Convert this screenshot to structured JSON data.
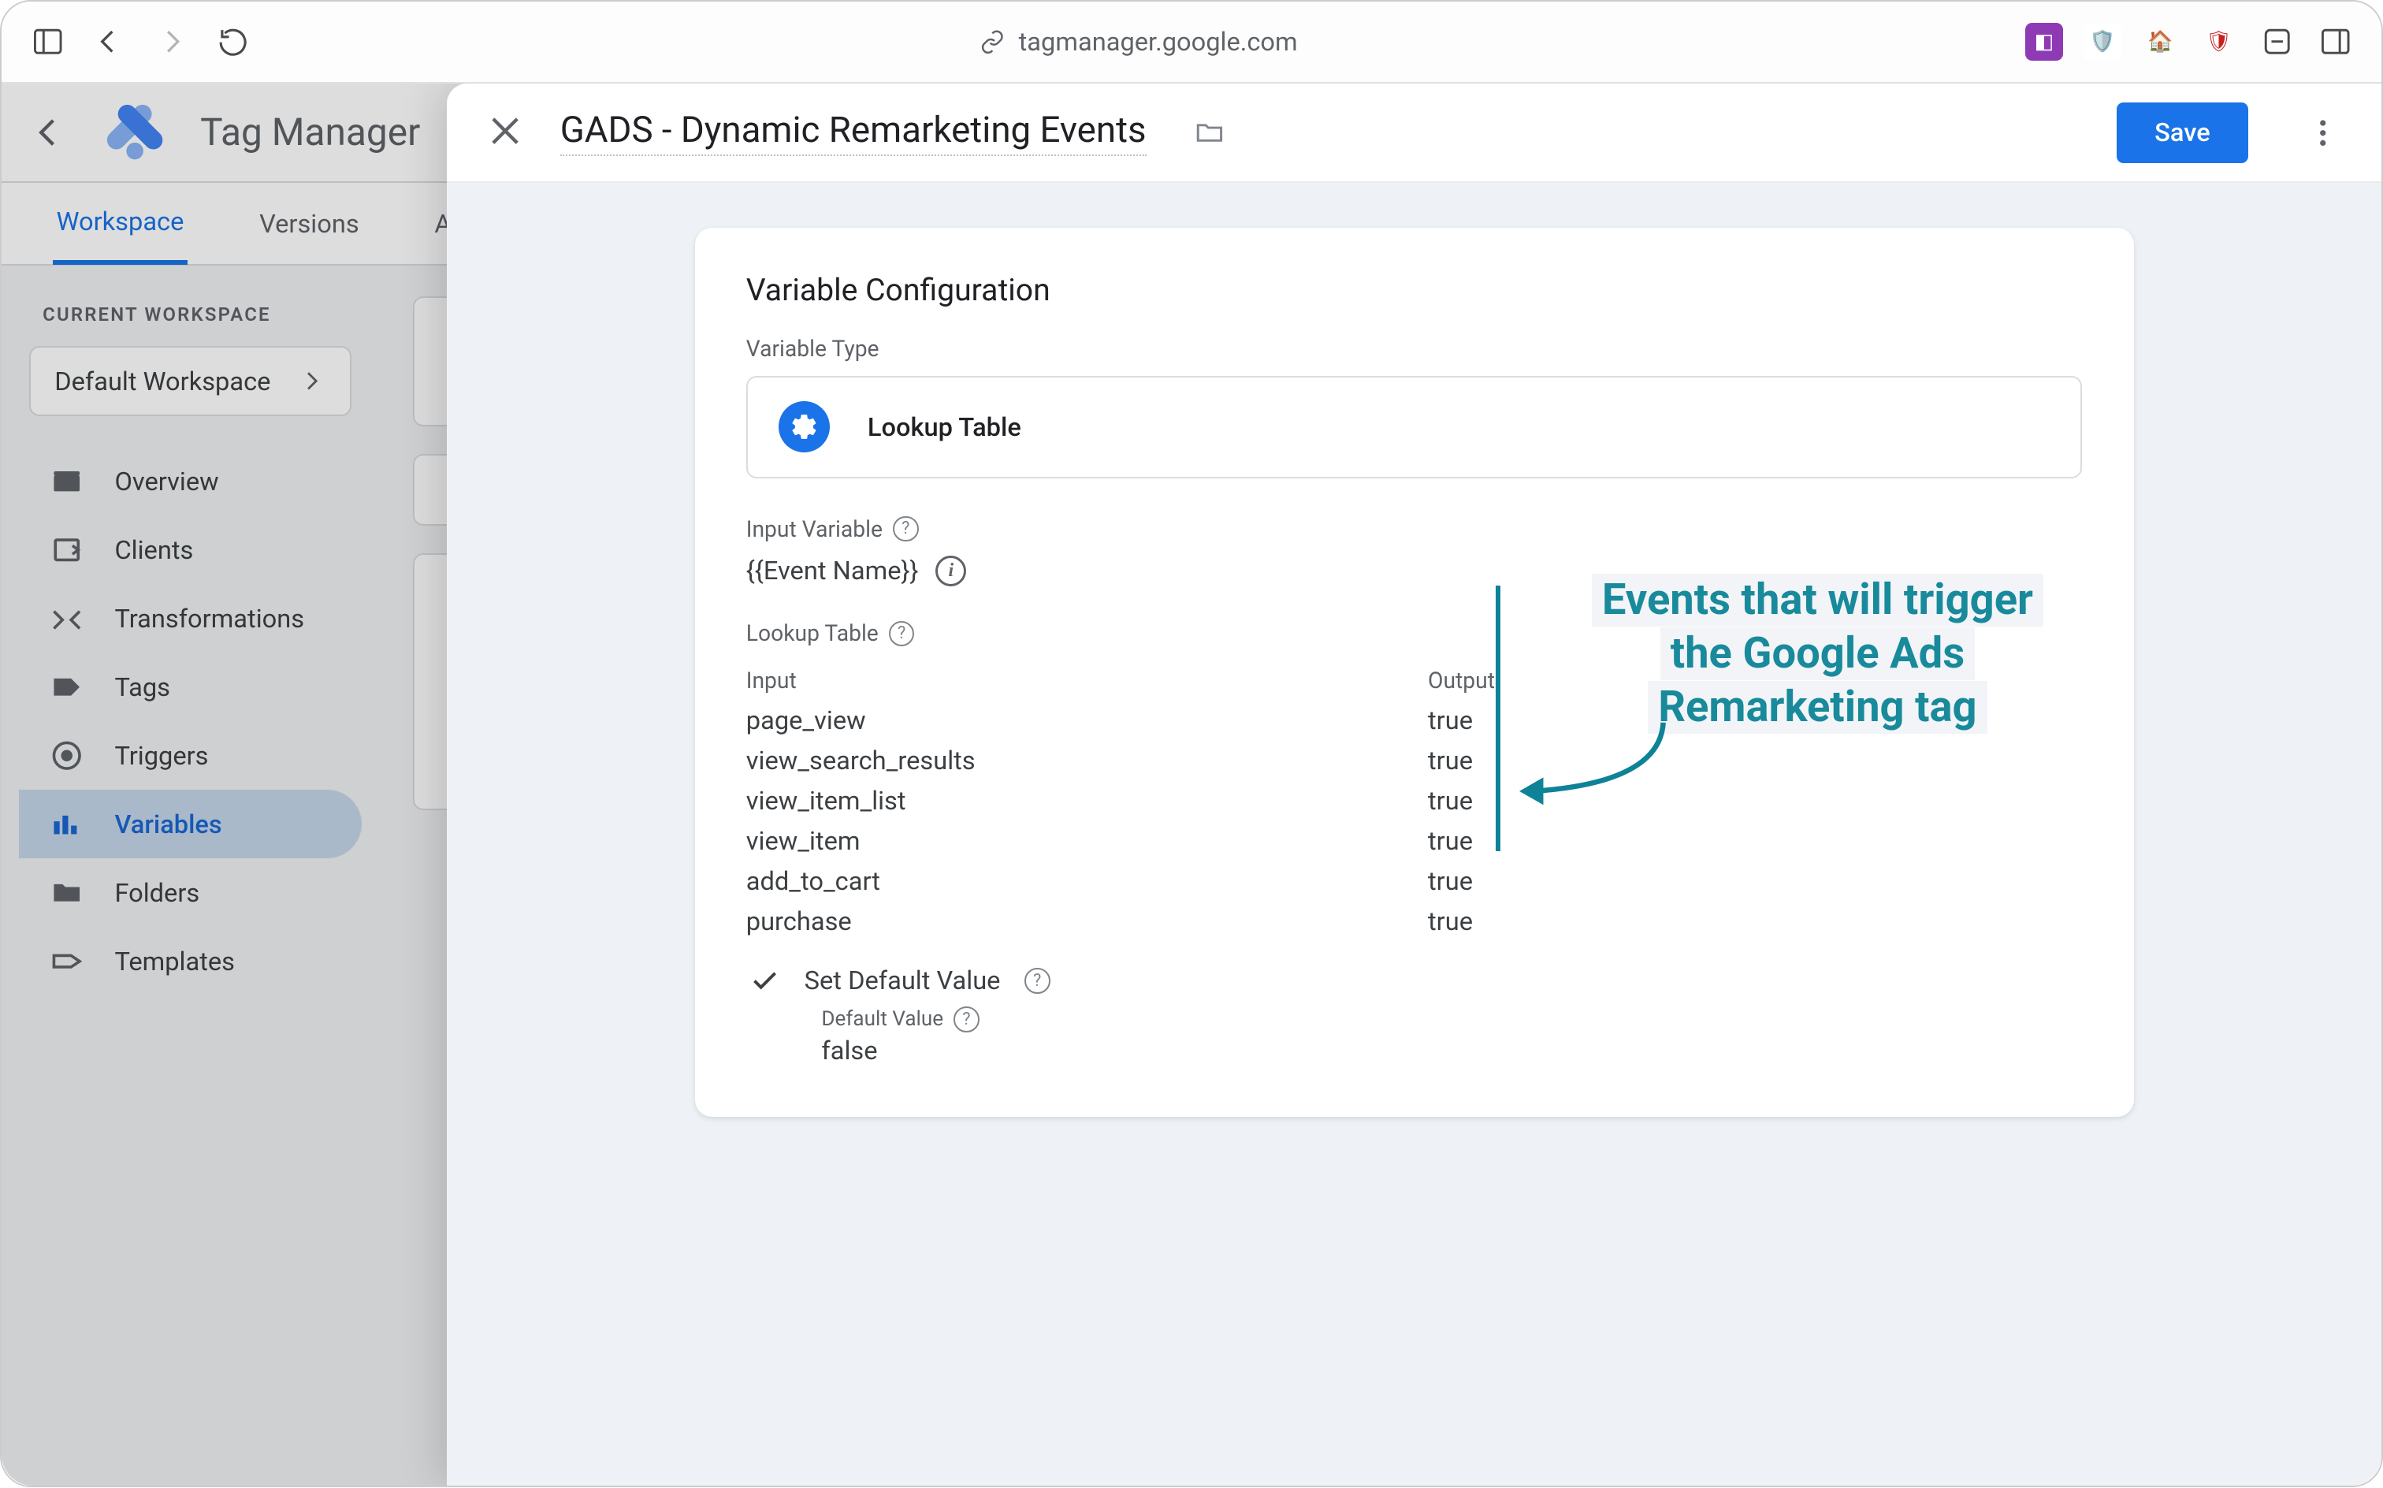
{
  "browser": {
    "url": "tagmanager.google.com"
  },
  "gtm": {
    "product": "Tag Manager",
    "tabs": {
      "workspace": "Workspace",
      "versions": "Versions",
      "admin": "Admin"
    },
    "ws_label": "CURRENT WORKSPACE",
    "ws_name": "Default Workspace",
    "nav": {
      "overview": "Overview",
      "clients": "Clients",
      "transformations": "Transformations",
      "tags": "Tags",
      "triggers": "Triggers",
      "variables": "Variables",
      "folders": "Folders",
      "templates": "Templates"
    }
  },
  "modal": {
    "title": "GADS -  Dynamic Remarketing Events",
    "save": "Save",
    "card_title": "Variable Configuration",
    "type_label": "Variable Type",
    "type_name": "Lookup Table",
    "input_var_label": "Input Variable",
    "input_var_value": "{{Event Name}}",
    "lookup_label": "Lookup Table",
    "headers": {
      "input": "Input",
      "output": "Output"
    },
    "rows": [
      {
        "input": "page_view",
        "output": "true"
      },
      {
        "input": "view_search_results",
        "output": "true"
      },
      {
        "input": "view_item_list",
        "output": "true"
      },
      {
        "input": "view_item",
        "output": "true"
      },
      {
        "input": "add_to_cart",
        "output": "true"
      },
      {
        "input": "purchase",
        "output": "true"
      }
    ],
    "set_default": "Set Default Value",
    "default_label": "Default Value",
    "default_value": "false"
  },
  "annotation": {
    "line1": "Events that will trigger",
    "line2": "the Google Ads",
    "line3": "Remarketing tag"
  }
}
